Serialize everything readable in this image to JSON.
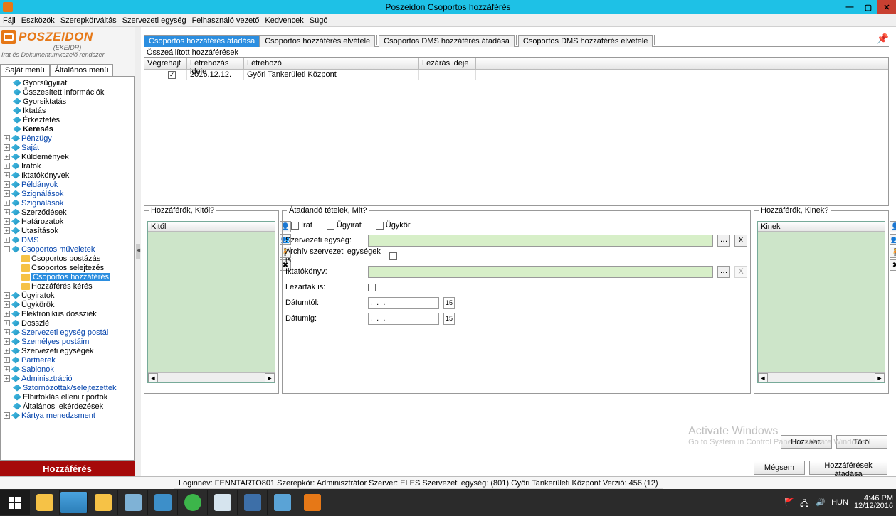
{
  "window": {
    "title": "Poszeidon Csoportos hozzáférés"
  },
  "menubar": [
    "Fájl",
    "Eszközök",
    "Szerepkörváltás",
    "Szervezeti egység",
    "Felhasználó vezető",
    "Kedvencek",
    "Súgó"
  ],
  "logo": {
    "name": "POSZEIDON",
    "sub1": "(EKEIDR)",
    "sub2": "Irat és Dokumentumkezelő rendszer"
  },
  "sidetabs": {
    "sajat": "Saját menü",
    "altalanos": "Általános menü"
  },
  "tree": {
    "gyorsugyirat": "Gyorsügyirat",
    "osszesitett": "Összesített információk",
    "gyorsiktatas": "Gyorsiktatás",
    "iktatas": "Iktatás",
    "erkeztetes": "Érkeztetés",
    "kereses": "Keresés",
    "penzugy": "Pénzügy",
    "sajat": "Saját",
    "kuldemenyek": "Küldemények",
    "iratok": "Iratok",
    "iktatokonyvek": "Iktatókönyvek",
    "peldanyok": "Példányok",
    "szignalasok1": "Szignálások",
    "szignalasok2": "Szignálások",
    "szerzodesek": "Szerződések",
    "hatarozatok": "Határozatok",
    "utasitasok": "Utasítások",
    "dms": "DMS",
    "csoportos_m": "Csoportos műveletek",
    "csop_post": "Csoportos postázás",
    "csop_sel": "Csoportos selejtezés",
    "csop_hoz": "Csoportos hozzáférés",
    "hoz_keres": "Hozzáférés kérés",
    "ugyiratok": "Ügyiratok",
    "ugykorok": "Ügykörök",
    "elektronikus": "Elektronikus dossziék",
    "dosszie": "Dosszié",
    "szerv_postai": "Szervezeti egység postái",
    "szemelyes": "Személyes postáim",
    "szerv_egys": "Szervezeti egységek",
    "partnerek": "Partnerek",
    "sablonok": "Sablonok",
    "admin": "Adminisztráció",
    "sztorno": "Sztornózottak/selejtezettek",
    "elbirt": "Elbirtoklás elleni riportok",
    "altalanos_lek": "Általános lekérdezések",
    "kartya": "Kártya menedzsment"
  },
  "left_footer": "Hozzáférés",
  "tabs": {
    "t1": "Csoportos hozzáférés átadása",
    "t2": "Csoportos hozzáférés elvétele",
    "t3": "Csoportos DMS hozzáférés átadása",
    "t4": "Csoportos DMS hozzáférés elvétele"
  },
  "group_label": "Összeállított hozzáférések",
  "table": {
    "h1": "Végrehajt",
    "h2": "Létrehozás ideje",
    "h3": "Létrehozó",
    "h4": "Lezárás ideje",
    "r1_date": "2016.12.12.",
    "r1_creator": "Győri Tankerületi Központ"
  },
  "left_fs": {
    "legend": "Hozzáférők, Kitől?",
    "hdr": "Kitől"
  },
  "mid_fs": {
    "legend": "Átadandó tételek, Mit?",
    "irat": "Irat",
    "ugyirat": "Ügyirat",
    "ugykor": "Ügykör",
    "szerv": "Szervezeti egység:",
    "archiv": "Archív szervezeti egységek is:",
    "iktato": "Iktatókönyv:",
    "lezartak": "Lezártak is:",
    "datumtol": "Dátumtól:",
    "datumig": "Dátumig:",
    "mask": ".  .  ."
  },
  "right_fs": {
    "legend": "Hozzáférők, Kinek?",
    "hdr": "Kinek"
  },
  "buttons": {
    "hozzaad": "Hozzáad",
    "torol": "Töröl",
    "megsem": "Mégsem",
    "atadas": "Hozzáférések átadása"
  },
  "watermark": {
    "l1": "Activate Windows",
    "l2": "Go to System in Control Panel to activate Windows."
  },
  "status": "Loginnév: FENNTARTO801   Szerepkör: Adminisztrátor   Szerver: ELES   Szervezeti egység: (801) Győri Tankerületi Központ   Verzió: 456 (12)",
  "tray": {
    "lang": "HUN",
    "time": "4:46 PM",
    "date": "12/12/2016"
  }
}
